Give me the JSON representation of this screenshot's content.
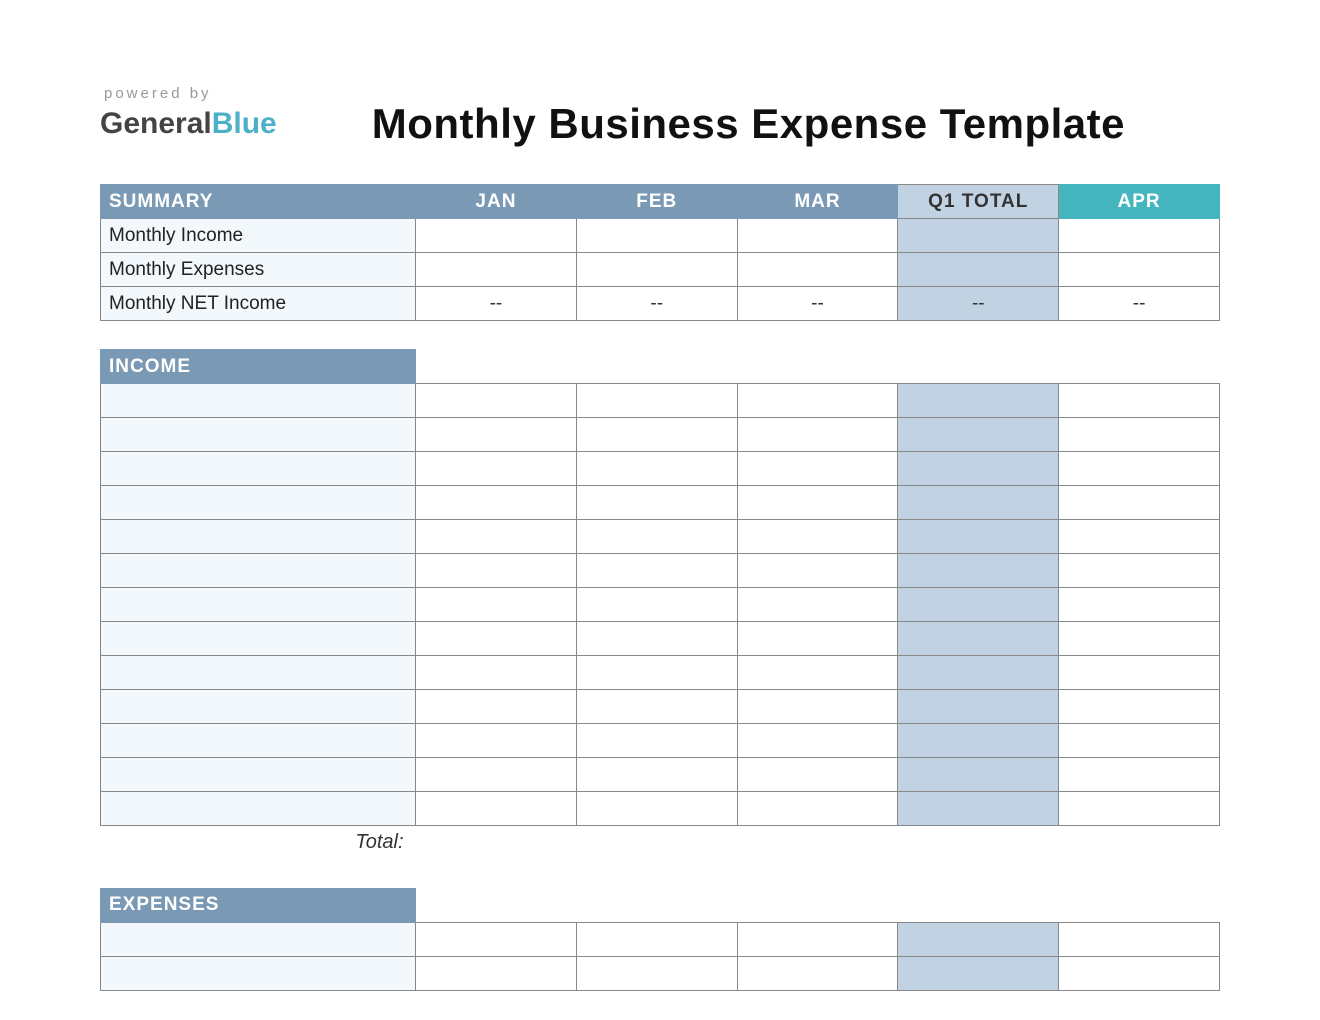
{
  "branding": {
    "powered_by": "powered by",
    "brand_general": "General",
    "brand_blue": "Blue"
  },
  "page_title": "Monthly Business Expense Template",
  "columns": {
    "summary": "SUMMARY",
    "jan": "JAN",
    "feb": "FEB",
    "mar": "MAR",
    "q1_total": "Q1 TOTAL",
    "apr": "APR"
  },
  "summary": {
    "rows": [
      {
        "label": "Monthly Income",
        "jan": "",
        "feb": "",
        "mar": "",
        "q1": "",
        "apr": ""
      },
      {
        "label": "Monthly Expenses",
        "jan": "",
        "feb": "",
        "mar": "",
        "q1": "",
        "apr": ""
      },
      {
        "label": "Monthly NET Income",
        "jan": "--",
        "feb": "--",
        "mar": "--",
        "q1": "--",
        "apr": "--"
      }
    ]
  },
  "income": {
    "header": "INCOME",
    "rows": 13,
    "total_label": "Total:"
  },
  "expenses": {
    "header": "EXPENSES",
    "rows": 2
  },
  "colors": {
    "header_blue": "#7a99b4",
    "q1_fill": "#c1d3e3",
    "apr_teal": "#45b6bf",
    "row_tint": "#f2f8fb",
    "brand_teal": "#4db0c9"
  }
}
